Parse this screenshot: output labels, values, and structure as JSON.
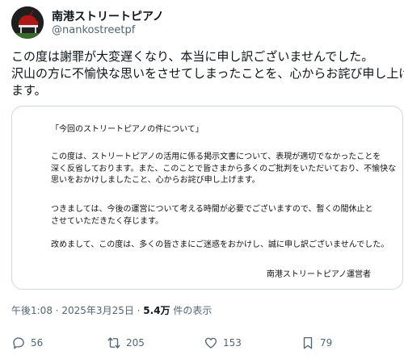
{
  "author": {
    "display_name": "南港ストリートピアノ",
    "handle": "@nankostreetpf"
  },
  "tweet": {
    "lines": [
      "この度は謝罪が大変遅くなり、本当に申し訳ございませんでした。",
      "沢山の方に不愉快な思いをさせてしまったことを、心からお詫び申し上げ",
      "ます。"
    ]
  },
  "document": {
    "title": "「今回のストリートピアノの件について」",
    "paragraph1": [
      "この度は、ストリートピアノの活用に係る掲示文書について、表現が適切でなかったことを",
      "深く反省しております。また、このことで皆さまから多くのご批判をいただいており、不愉快な",
      "思いをおかけしましたこと、心からお詫び申し上げます。"
    ],
    "paragraph2": [
      "つきましては、今後の運営について考える時間が必要でございますので、暫くの間休止と",
      "させていただきたく存じます。"
    ],
    "paragraph3": [
      "改めまして、この度は、多くの皆さまにご迷惑をおかけし、誠に申し訳ございませんでした。"
    ],
    "signature": "南港ストリートピアノ運営者"
  },
  "meta": {
    "timestamp": "午後1:08 · 2025年3月25日 · ",
    "views_count": "5.4万",
    "views_label": " 件の表示"
  },
  "actions": {
    "reply_count": "56",
    "retweet_count": "205",
    "like_count": "153",
    "bookmark_count": "79"
  },
  "icons": {
    "reply": "speech-bubble-icon",
    "retweet": "retweet-arrows-icon",
    "like": "heart-icon",
    "bookmark": "bookmark-icon"
  },
  "colors": {
    "text_primary": "#0f1419",
    "text_secondary": "#536471",
    "border": "#cfd9de"
  }
}
